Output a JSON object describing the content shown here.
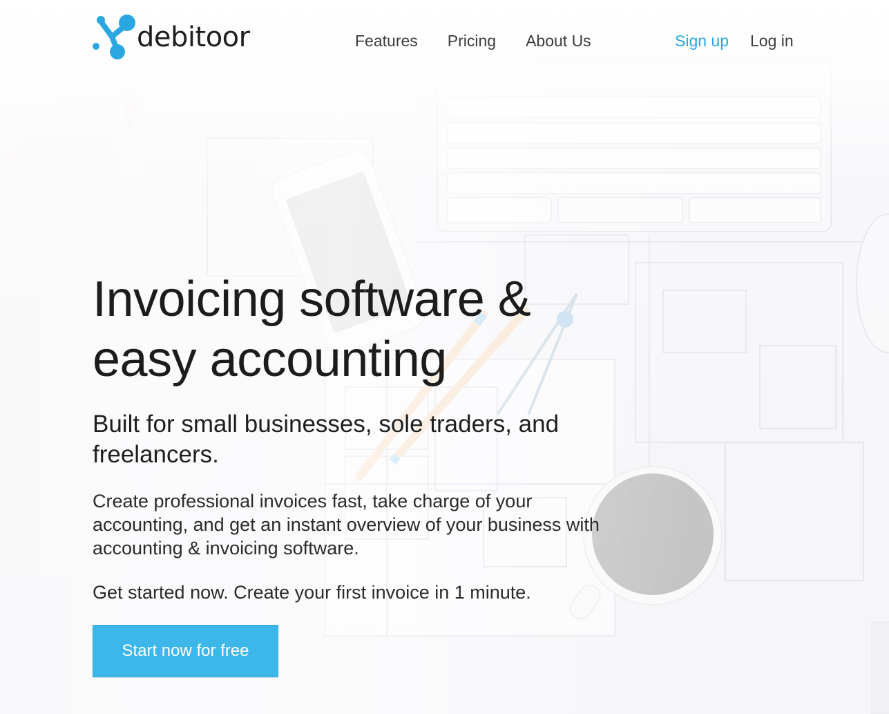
{
  "brand": {
    "name": "debitoor",
    "accent": "#2aa7e0",
    "logo_icon": "molecule-logo-icon"
  },
  "nav": {
    "items": [
      {
        "label": "Features"
      },
      {
        "label": "Pricing"
      },
      {
        "label": "About Us"
      }
    ],
    "signup_label": "Sign up",
    "login_label": "Log in"
  },
  "hero": {
    "title_line1": "Invoicing software &",
    "title_line2": "easy accounting",
    "subtitle": "Built for small businesses, sole traders, and freelancers.",
    "description": "Create professional invoices fast, take charge of your accounting, and get an instant overview of your business with accounting & invoicing software.",
    "cta_text": "Get started now. Create your first invoice in 1 minute.",
    "cta_button": "Start now for free",
    "cta_color": "#3db7ea"
  }
}
